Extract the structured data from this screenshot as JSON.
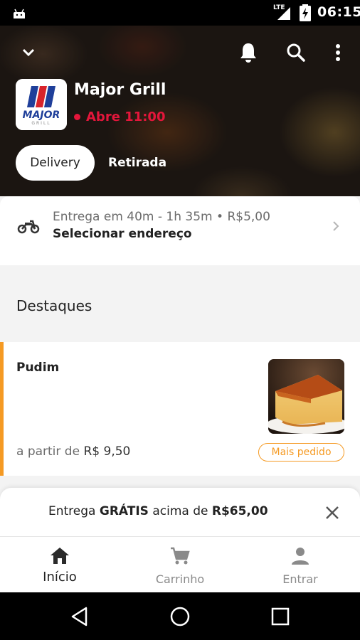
{
  "status_bar": {
    "network": "LTE",
    "time": "06:15"
  },
  "header": {
    "store_name": "Major Grill",
    "store_status": "Abre 11:00",
    "logo_text": "MAJOR",
    "logo_subtext": "GRILL",
    "tabs": [
      {
        "label": "Delivery",
        "selected": true
      },
      {
        "label": "Retirada",
        "selected": false
      }
    ],
    "icons": [
      "chevron-down-icon",
      "bell-icon",
      "search-icon",
      "more-vert-icon"
    ]
  },
  "delivery_info": {
    "estimate": "Entrega em 40m - 1h 35m • R$5,00",
    "action": "Selecionar endereço"
  },
  "section": {
    "title": "Destaques"
  },
  "product": {
    "name": "Pudim",
    "price_prefix": "a partir de",
    "price": "R$ 9,50",
    "badge": "Mais pedido"
  },
  "banner": {
    "text_prefix": "Entrega ",
    "text_bold": "GRÁTIS",
    "text_middle": " acima de ",
    "text_amount": "R$65,00"
  },
  "bottom_nav": {
    "items": [
      {
        "label": "Início",
        "icon": "home-icon",
        "active": true
      },
      {
        "label": "Carrinho",
        "icon": "cart-icon",
        "active": false
      },
      {
        "label": "Entrar",
        "icon": "person-icon",
        "active": false
      }
    ]
  },
  "colors": {
    "accent_orange": "#f59a23",
    "status_red": "#e4163b",
    "logo_blue": "#1f3f9a",
    "logo_red": "#d8232a"
  }
}
